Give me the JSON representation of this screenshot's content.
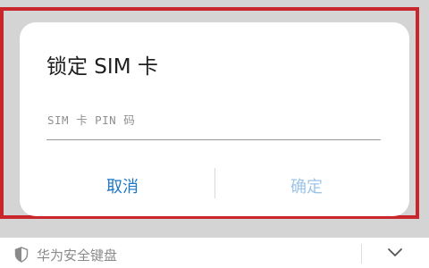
{
  "dialog": {
    "title": "锁定 SIM 卡",
    "pin_input": {
      "placeholder": "SIM 卡 PIN 码",
      "value": ""
    },
    "cancel_label": "取消",
    "confirm_label": "确定"
  },
  "keyboard_bar": {
    "label": "华为安全键盘",
    "shield_icon": "shield-icon",
    "collapse_icon": "chevron-down-icon"
  },
  "colors": {
    "highlight_border": "#c8262a",
    "cancel_text": "#1c77c6",
    "confirm_text_disabled": "#9cc4e8"
  }
}
